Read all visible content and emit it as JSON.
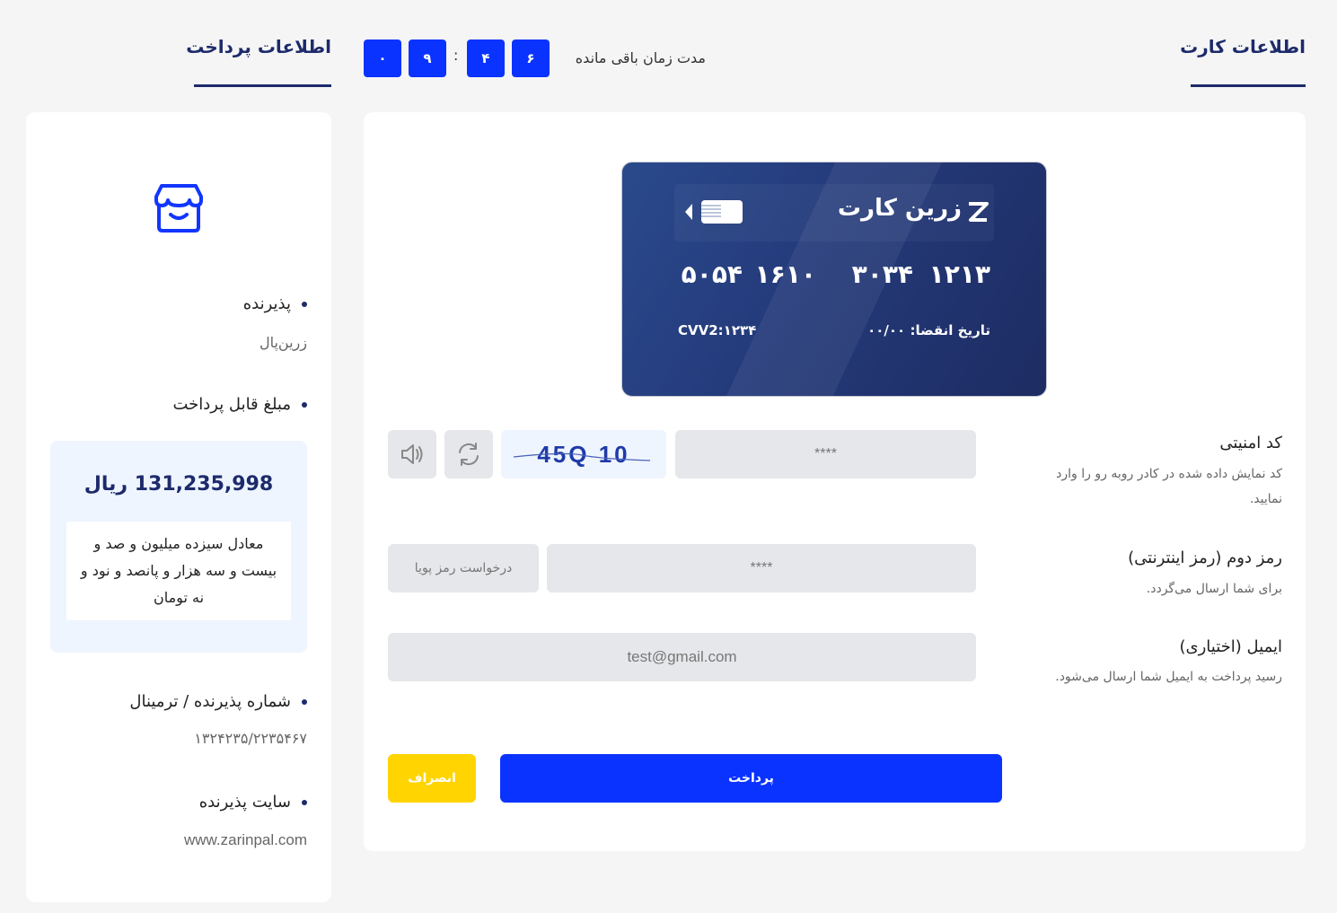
{
  "header": {
    "card_info_title": "اطلاعات کارت",
    "payment_info_title": "اطلاعات پرداخت",
    "timer_label": "مدت زمان باقی مانده",
    "timer_digits": [
      "۶",
      "۴",
      "۹",
      "۰"
    ],
    "timer_separator": ":"
  },
  "sidebar": {
    "icon": "store-icon",
    "merchant_label": "پذیرنده",
    "merchant_value": "زرین‌پال",
    "amount_label": "مبلغ قابل پرداخت",
    "amount_value": "131,235,998 ریال",
    "amount_words": "معادل سیزده میلیون و صد و بیست و سه هزار و پانصد و نود و نه تومان",
    "terminal_label": "شماره پذیرنده / ترمینال",
    "terminal_value": "۱۳۲۴۲۳۵/۲۲۳۵۴۶۷",
    "site_label": "سایت پذیرنده",
    "site_value": "www.zarinpal.com"
  },
  "card": {
    "brand": "زرین کارت",
    "number_groups": [
      "۱۲۱۳",
      "۳۰۳۴",
      "۱۶۱۰",
      "۵۰۵۴"
    ],
    "expiry": "تاریخ انقضا: ۰۰/۰۰",
    "cvv2": "CVV2:۱۲۳۴"
  },
  "form": {
    "captcha_label": "کد امنیتی",
    "captcha_help": "کد نمایش داده شده در کادر روبه رو را وارد نمایید.",
    "captcha_placeholder": "****",
    "captcha_text": "45Q 10",
    "password_label": "رمز دوم (رمز اینترنتی)",
    "password_help": "برای شما ارسال می‌گردد.",
    "password_placeholder": "****",
    "otp_button": "درخواست رمز پویا",
    "email_label": "ایمیل (اختیاری)",
    "email_help": "رسید پرداخت به ایمیل شما ارسال می‌شود.",
    "email_placeholder": "test@gmail.com",
    "pay_button": "پرداخت",
    "cancel_button": "انصراف"
  },
  "colors": {
    "primary": "#0a33ff",
    "navy": "#1d2a6b",
    "cancel": "#ffd400"
  }
}
